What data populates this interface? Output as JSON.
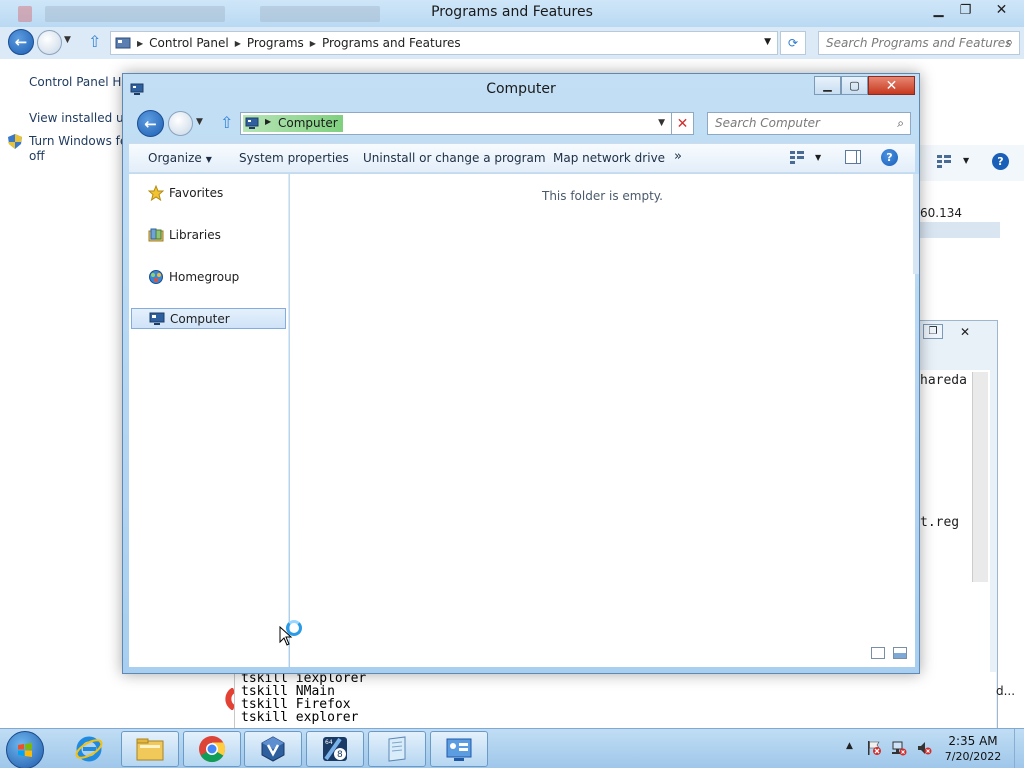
{
  "background_window": {
    "title": "Programs and Features",
    "breadcrumb": [
      "Control Panel",
      "Programs",
      "Programs and Features"
    ],
    "search_placeholder": "Search Programs and Features",
    "left_links": [
      "Control Panel Home",
      "View installed updates",
      "Turn Windows features on or",
      "off"
    ],
    "right_fragment": "60.134"
  },
  "background_win2": {
    "lines": [
      "hareda",
      "t.reg"
    ]
  },
  "console": {
    "lines": [
      "tskill iexplorer",
      "tskill NMain",
      "tskill Firefox",
      "tskill explorer"
    ],
    "trailing": "d..."
  },
  "explorer": {
    "title": "Computer",
    "address": "Computer",
    "search_placeholder": "Search Computer",
    "commands": {
      "organize": "Organize",
      "system_properties": "System properties",
      "uninstall": "Uninstall or change a program",
      "map_drive": "Map network drive",
      "more": "»"
    },
    "nav": [
      {
        "label": "Favorites"
      },
      {
        "label": "Libraries"
      },
      {
        "label": "Homegroup"
      },
      {
        "label": "Computer"
      }
    ],
    "empty_message": "This folder is empty."
  },
  "taskbar": {
    "clock_time": "2:35 AM",
    "clock_date": "7/20/2022"
  },
  "colors": {
    "accent": "#1e5fb3",
    "selection": "#cfe3f8",
    "close": "#c6391f"
  }
}
